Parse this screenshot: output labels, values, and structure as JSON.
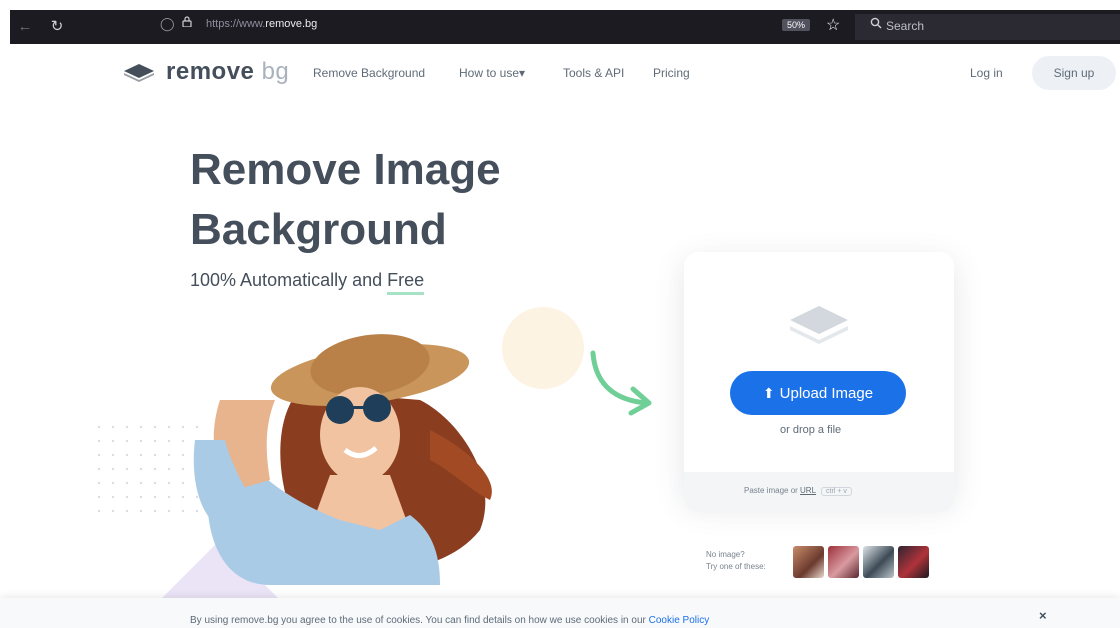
{
  "browser": {
    "url_prefix": "https://www.",
    "url_domain": "remove.bg",
    "zoom": "50%",
    "search_placeholder": "Search"
  },
  "site": {
    "logo_main": "remove",
    "logo_suffix": "bg",
    "nav": [
      "Remove Background",
      "How to use",
      "Tools & API",
      "Pricing"
    ],
    "nav_dropdown_marker": "▾",
    "login": "Log in",
    "signup": "Sign up"
  },
  "hero": {
    "title_line1": "Remove Image",
    "title_line2": "Background",
    "subtitle_prefix": "100% Automatically and ",
    "subtitle_emphasis": "Free"
  },
  "upload": {
    "button": "Upload Image",
    "drop_text": "or drop a file",
    "paste_prefix": "Paste image or ",
    "paste_link": "URL",
    "paste_shortcut": "ctrl + v"
  },
  "samples": {
    "line1": "No image?",
    "line2": "Try one of these:"
  },
  "cookie": {
    "text": "By using remove.bg you agree to the use of cookies. You can find details on how we use cookies in our ",
    "link": "Cookie Policy",
    "close": "×"
  },
  "colors": {
    "primary": "#1b71e8",
    "heading": "#454f5b",
    "accent_green": "#6fcf97"
  }
}
